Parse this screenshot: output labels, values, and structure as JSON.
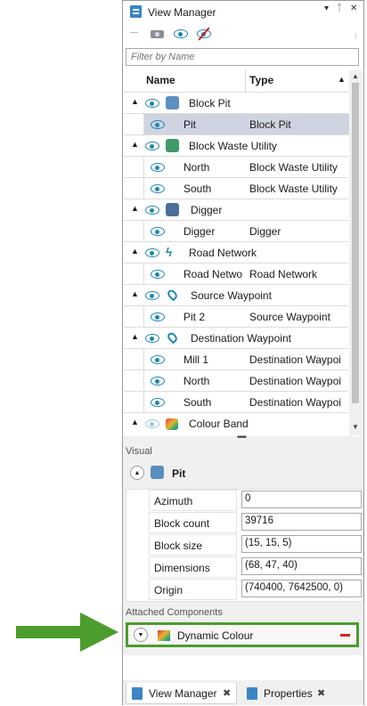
{
  "panel": {
    "title": "View Manager",
    "pin_glyph": "▾ ⊥ ✕"
  },
  "toolbar": {
    "icons": [
      "minus-icon",
      "camera-icon",
      "eye-icon",
      "eye-off-icon"
    ]
  },
  "filter": {
    "placeholder": "Filter by Name"
  },
  "grid": {
    "col_name": "Name",
    "col_type": "Type",
    "groups": [
      {
        "label": "Block Pit",
        "rows": [
          {
            "name": "Pit",
            "type": "Block Pit",
            "selected": true
          }
        ]
      },
      {
        "label": "Block Waste Utility",
        "rows": [
          {
            "name": "North",
            "type": "Block Waste Utility"
          },
          {
            "name": "South",
            "type": "Block Waste Utility"
          }
        ]
      },
      {
        "label": "Digger",
        "rows": [
          {
            "name": "Digger",
            "type": "Digger"
          }
        ]
      },
      {
        "label": "Road Network",
        "rows": [
          {
            "name": "Road Netwo",
            "type": "Road Network"
          }
        ]
      },
      {
        "label": "Source Waypoint",
        "rows": [
          {
            "name": "Pit 2",
            "type": "Source Waypoint"
          }
        ]
      },
      {
        "label": "Destination Waypoint",
        "rows": [
          {
            "name": "Mill 1",
            "type": "Destination Waypoi"
          },
          {
            "name": "North",
            "type": "Destination Waypoi"
          },
          {
            "name": "South",
            "type": "Destination Waypoi"
          }
        ]
      },
      {
        "label": "Colour Band",
        "rows": []
      }
    ]
  },
  "visual": {
    "section_label": "Visual",
    "object_name": "Pit",
    "properties": [
      {
        "label": "Azimuth",
        "value": "0"
      },
      {
        "label": "Block count",
        "value": "39716"
      },
      {
        "label": "Block size",
        "value": "(15, 15, 5)"
      },
      {
        "label": "Dimensions",
        "value": "(68, 47, 40)"
      },
      {
        "label": "Origin",
        "value": "(740400, 7642500, 0)"
      }
    ]
  },
  "attached": {
    "section_label": "Attached Components",
    "component": "Dynamic Colour"
  },
  "tabs": [
    {
      "label": "View Manager",
      "close": "✖",
      "active": true
    },
    {
      "label": "Properties",
      "close": "✖",
      "active": false
    }
  ],
  "colors": {
    "accent": "#1d86b4",
    "highlight": "#4c9c2e",
    "selection": "#cfd4e1",
    "remove": "#e02020"
  }
}
